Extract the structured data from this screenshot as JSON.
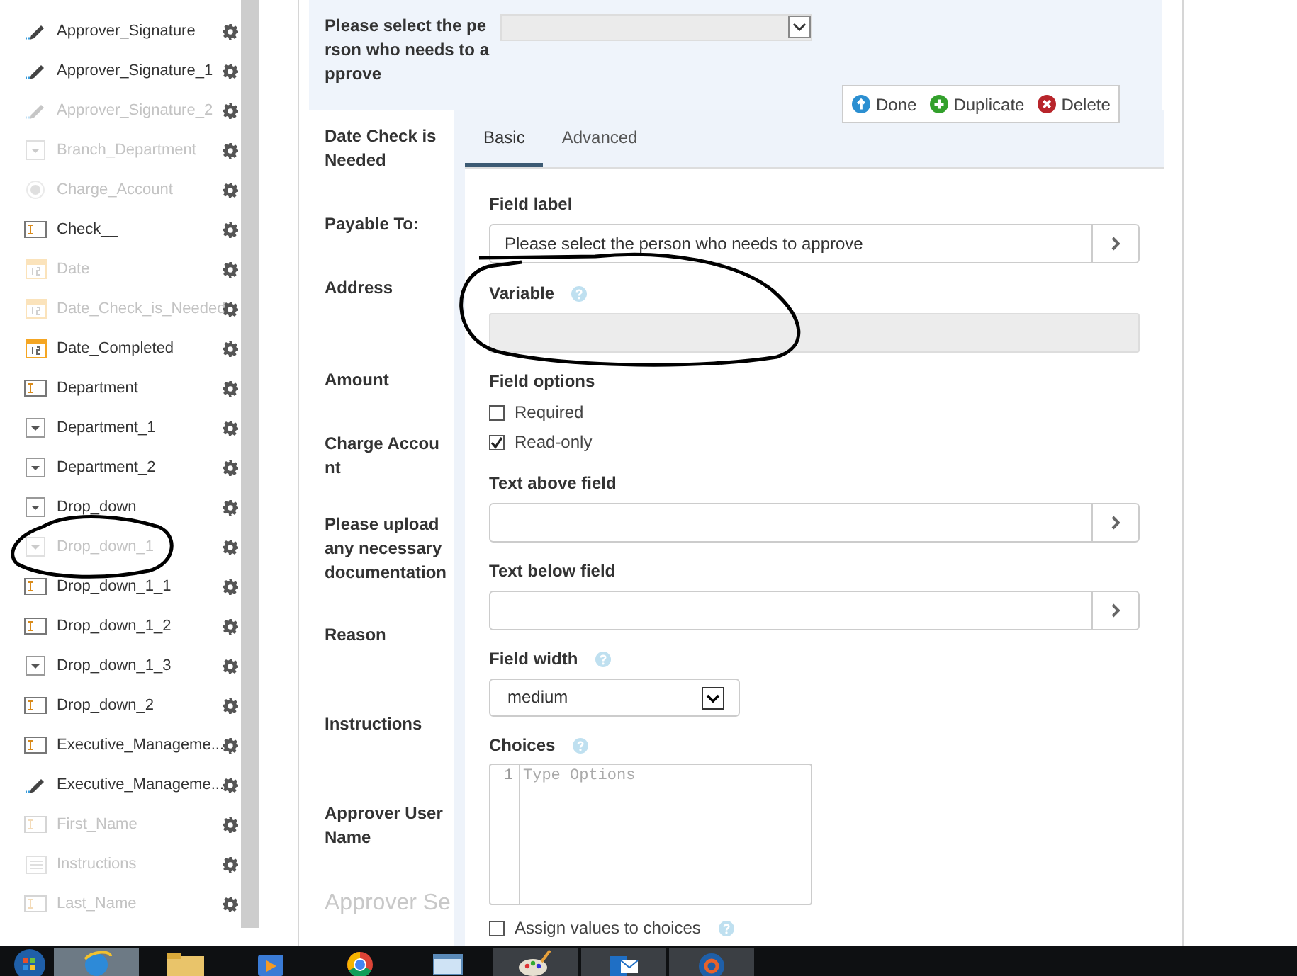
{
  "sidebar": {
    "items": [
      {
        "label": "Approver_Signature",
        "kind": "signature",
        "disabled": false
      },
      {
        "label": "Approver_Signature_1",
        "kind": "signature",
        "disabled": false
      },
      {
        "label": "Approver_Signature_2",
        "kind": "signature",
        "disabled": true
      },
      {
        "label": "Branch_Department",
        "kind": "dropdown",
        "disabled": true
      },
      {
        "label": "Charge_Account",
        "kind": "radio",
        "disabled": true
      },
      {
        "label": "Check__",
        "kind": "text",
        "disabled": false
      },
      {
        "label": "Date",
        "kind": "date",
        "disabled": true
      },
      {
        "label": "Date_Check_is_Needed",
        "kind": "date",
        "disabled": true
      },
      {
        "label": "Date_Completed",
        "kind": "date",
        "disabled": false
      },
      {
        "label": "Department",
        "kind": "text",
        "disabled": false
      },
      {
        "label": "Department_1",
        "kind": "dropdown",
        "disabled": false
      },
      {
        "label": "Department_2",
        "kind": "dropdown",
        "disabled": false
      },
      {
        "label": "Drop_down",
        "kind": "dropdown",
        "disabled": false
      },
      {
        "label": "Drop_down_1",
        "kind": "dropdown",
        "disabled": true
      },
      {
        "label": "Drop_down_1_1",
        "kind": "text",
        "disabled": false
      },
      {
        "label": "Drop_down_1_2",
        "kind": "text",
        "disabled": false
      },
      {
        "label": "Drop_down_1_3",
        "kind": "dropdown",
        "disabled": false
      },
      {
        "label": "Drop_down_2",
        "kind": "text",
        "disabled": false
      },
      {
        "label": "Executive_Manageme...",
        "kind": "text",
        "disabled": false
      },
      {
        "label": "Executive_Manageme...",
        "kind": "signature",
        "disabled": false
      },
      {
        "label": "First_Name",
        "kind": "text",
        "disabled": true
      },
      {
        "label": "Instructions",
        "kind": "paragraph",
        "disabled": true
      },
      {
        "label": "Last_Name",
        "kind": "text",
        "disabled": true
      }
    ]
  },
  "form_preview": {
    "select_label": "Please select the person who needs to approve",
    "labels": [
      "Date Check is Needed",
      "Payable To:",
      "Address",
      "Amount",
      "Charge Account",
      "Please upload any necessary documentation",
      "Reason",
      "Instructions",
      "Approver User Name"
    ],
    "section_heading": "Approver Se"
  },
  "actions": [
    {
      "label": "Done",
      "kind": "done"
    },
    {
      "label": "Duplicate",
      "kind": "duplicate"
    },
    {
      "label": "Delete",
      "kind": "delete"
    }
  ],
  "tabs": [
    {
      "label": "Basic",
      "selected": true
    },
    {
      "label": "Advanced",
      "selected": false
    }
  ],
  "properties": {
    "field_label": {
      "label": "Field label",
      "value": "Please select the person who needs to approve"
    },
    "variable": {
      "label": "Variable",
      "disabled": true
    },
    "field_options": {
      "label": "Field options",
      "options": [
        {
          "label": "Required",
          "checked": false
        },
        {
          "label": "Read-only",
          "checked": true
        }
      ]
    },
    "text_above": {
      "label": "Text above field"
    },
    "text_below": {
      "label": "Text below field"
    },
    "field_width": {
      "label": "Field width",
      "value": "medium"
    },
    "choices": {
      "label": "Choices",
      "line_number": "1",
      "placeholder": "Type Options"
    },
    "assign_values": {
      "label": "Assign values to choices",
      "checked": false
    }
  }
}
